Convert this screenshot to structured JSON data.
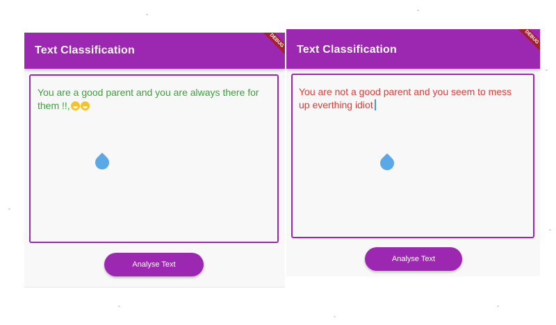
{
  "colors": {
    "primary": "#9c27b0",
    "positive_text": "#3aa23a",
    "negative_text": "#e53935",
    "debug_banner": "#a61e2a"
  },
  "screens": [
    {
      "appbar_title": "Text Classification",
      "debug_banner": "DEBUG",
      "input_text": "You are a good parent and you are always there for them !!,",
      "emoji_icons": [
        "grinning-face-icon",
        "grinning-face-icon"
      ],
      "button_label": "Analyse Text"
    },
    {
      "appbar_title": "Text Classification",
      "debug_banner": "DEBUG",
      "input_text": "You are not a good parent and you seem to mess up everthing  idiot",
      "button_label": "Analyse Text"
    }
  ]
}
